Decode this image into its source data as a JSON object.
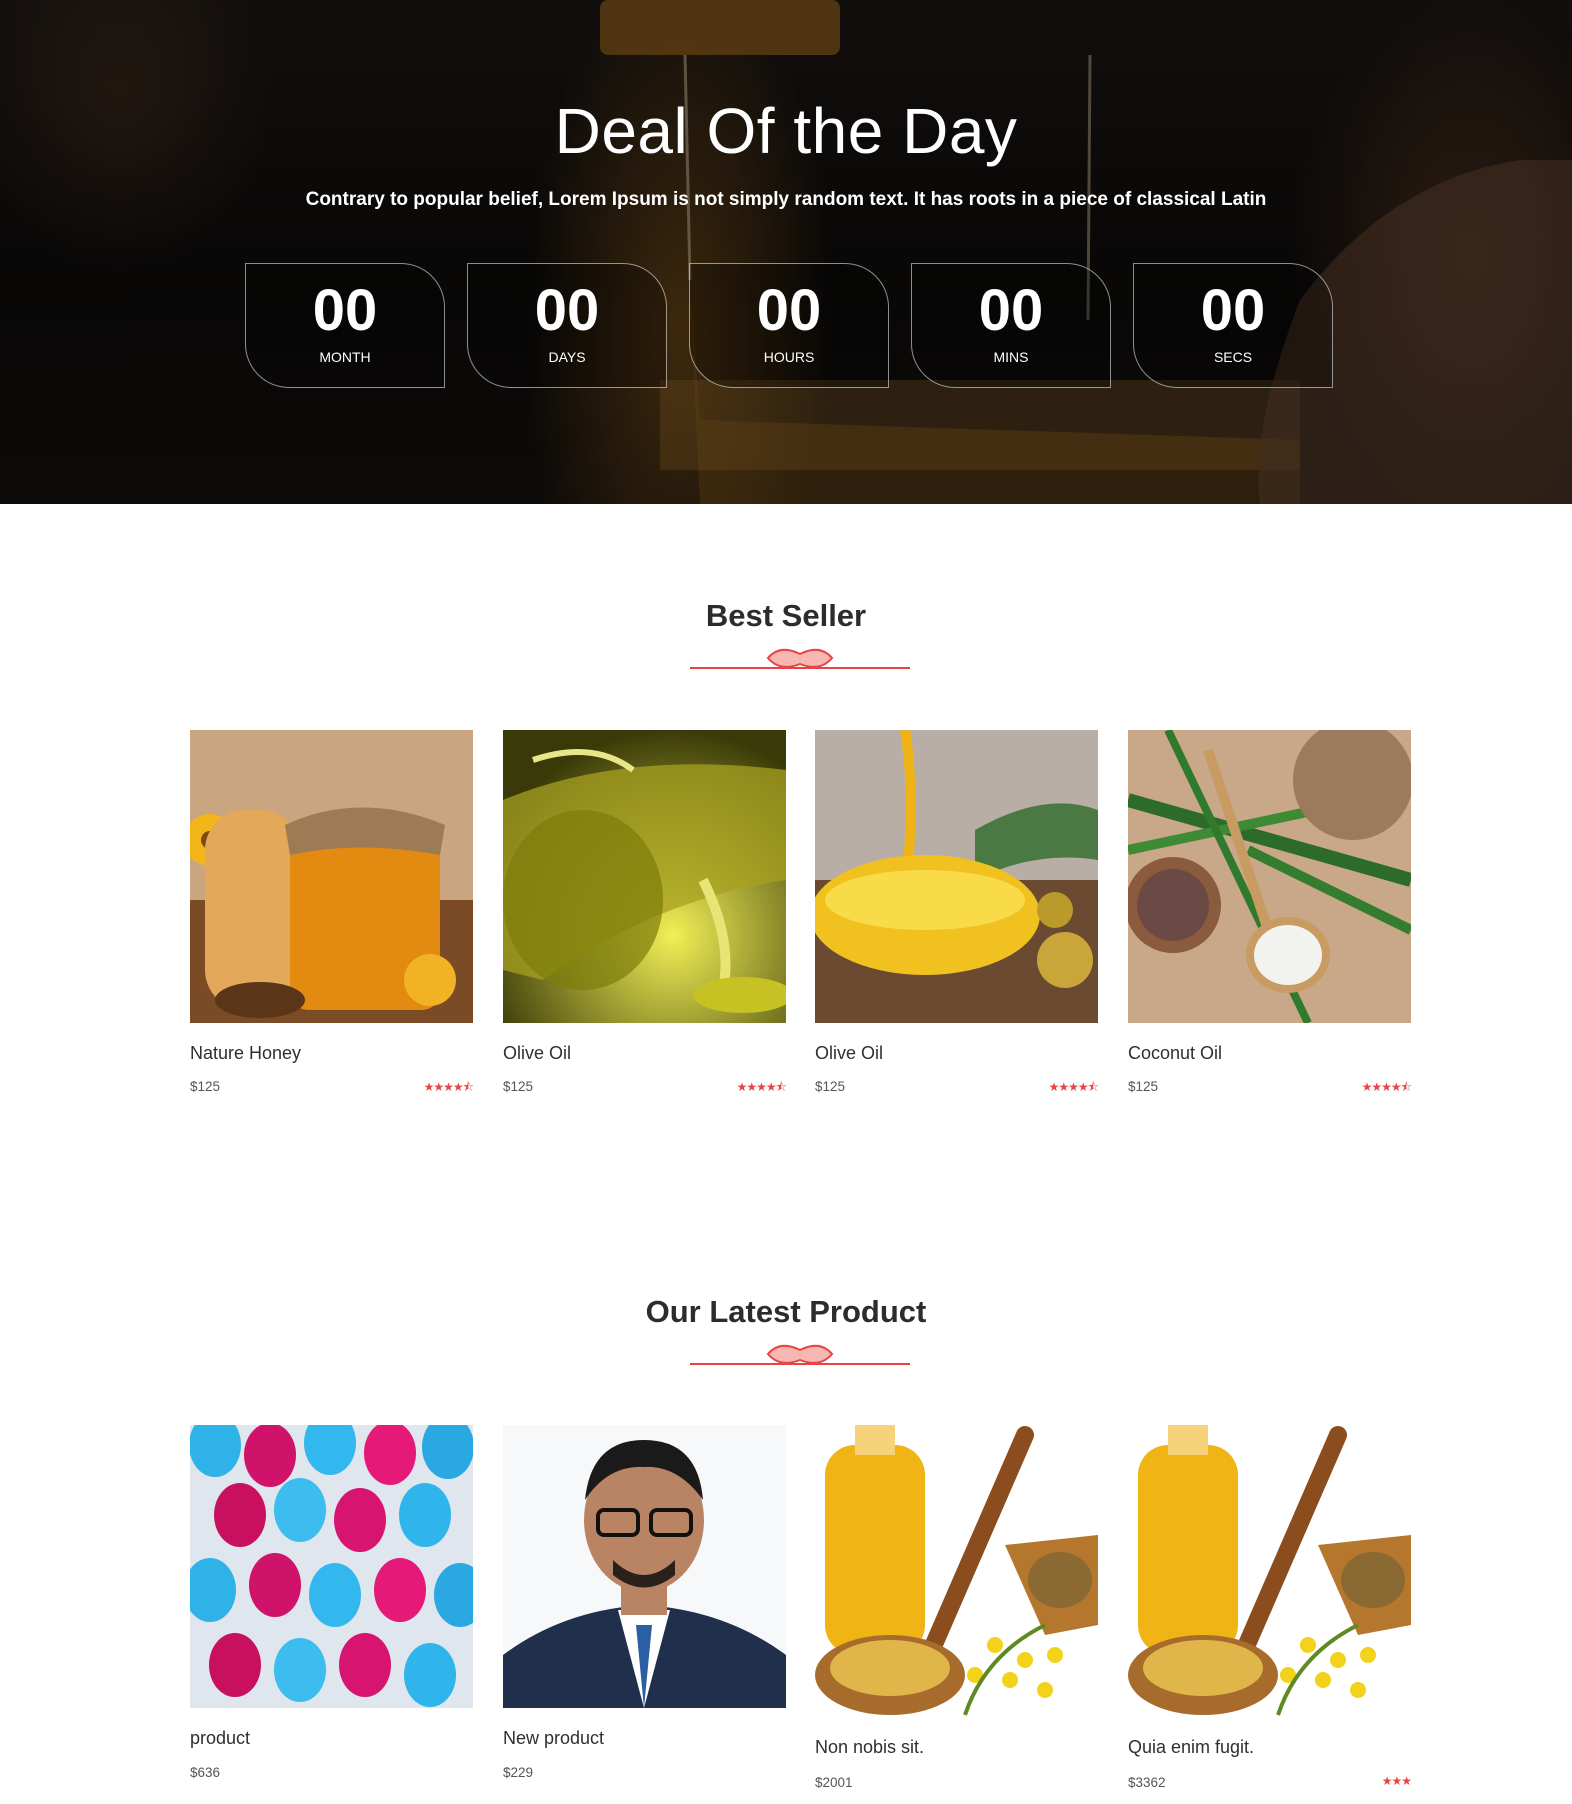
{
  "deal": {
    "title": "Deal Of the Day",
    "subtitle": "Contrary to popular belief, Lorem Ipsum is not simply random text. It has roots in a piece of classical Latin",
    "timer": [
      {
        "value": "00",
        "label": "MONTH"
      },
      {
        "value": "00",
        "label": "DAYS"
      },
      {
        "value": "00",
        "label": "HOURS"
      },
      {
        "value": "00",
        "label": "MINS"
      },
      {
        "value": "00",
        "label": "SECS"
      }
    ]
  },
  "best_seller": {
    "title": "Best Seller",
    "products": [
      {
        "name": "Nature Honey",
        "price": "$125",
        "rating": "★★★★⯪",
        "image": "honey-jar"
      },
      {
        "name": "Olive Oil",
        "price": "$125",
        "rating": "★★★★⯪",
        "image": "olive-oil-bottle"
      },
      {
        "name": "Olive Oil",
        "price": "$125",
        "rating": "★★★★⯪",
        "image": "olive-oil-bowl"
      },
      {
        "name": "Coconut Oil",
        "price": "$125",
        "rating": "★★★★⯪",
        "image": "coconut-oil"
      }
    ]
  },
  "latest": {
    "title": "Our Latest Product",
    "products": [
      {
        "name": "product",
        "price": "$636",
        "rating": "",
        "image": "balloons"
      },
      {
        "name": "New product",
        "price": "$229",
        "rating": "",
        "image": "man-portrait"
      },
      {
        "name": "Non nobis sit.",
        "price": "$2001",
        "rating": "",
        "image": "mustard-oil"
      },
      {
        "name": "Quia enim fugit.",
        "price": "$3362",
        "rating": "★★★",
        "image": "mustard-oil"
      }
    ]
  },
  "colors": {
    "accent": "#e94444",
    "divider_fill": "#f7b7b3",
    "hero_dark": "#120f0d"
  }
}
